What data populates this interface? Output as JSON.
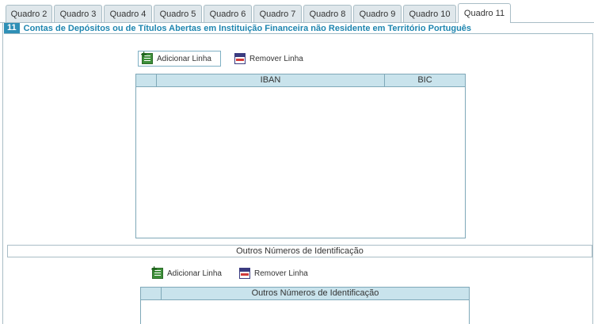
{
  "tabs": [
    {
      "label": "Quadro 2",
      "active": false
    },
    {
      "label": "Quadro 3",
      "active": false
    },
    {
      "label": "Quadro 4",
      "active": false
    },
    {
      "label": "Quadro 5",
      "active": false
    },
    {
      "label": "Quadro 6",
      "active": false
    },
    {
      "label": "Quadro 7",
      "active": false
    },
    {
      "label": "Quadro 8",
      "active": false
    },
    {
      "label": "Quadro 9",
      "active": false
    },
    {
      "label": "Quadro 10",
      "active": false
    },
    {
      "label": "Quadro 11",
      "active": true
    }
  ],
  "section": {
    "number": "11",
    "title": "Contas de Depósitos ou de Títulos Abertas em Instituição Financeira não Residente em Território Português"
  },
  "accounts": {
    "add_label": "Adicionar Linha",
    "remove_label": "Remover Linha",
    "columns": [
      "",
      "IBAN",
      "BIC"
    ],
    "rows": []
  },
  "other_ids": {
    "header": "Outros Números de Identificação",
    "add_label": "Adicionar Linha",
    "remove_label": "Remover Linha",
    "columns": [
      "",
      "Outros Números de Identificação"
    ],
    "rows": []
  },
  "colors": {
    "accent": "#2e8fb6",
    "title": "#1f86b0",
    "grid_header": "#c9e3ec",
    "tab_bg": "#dfe7eb"
  }
}
